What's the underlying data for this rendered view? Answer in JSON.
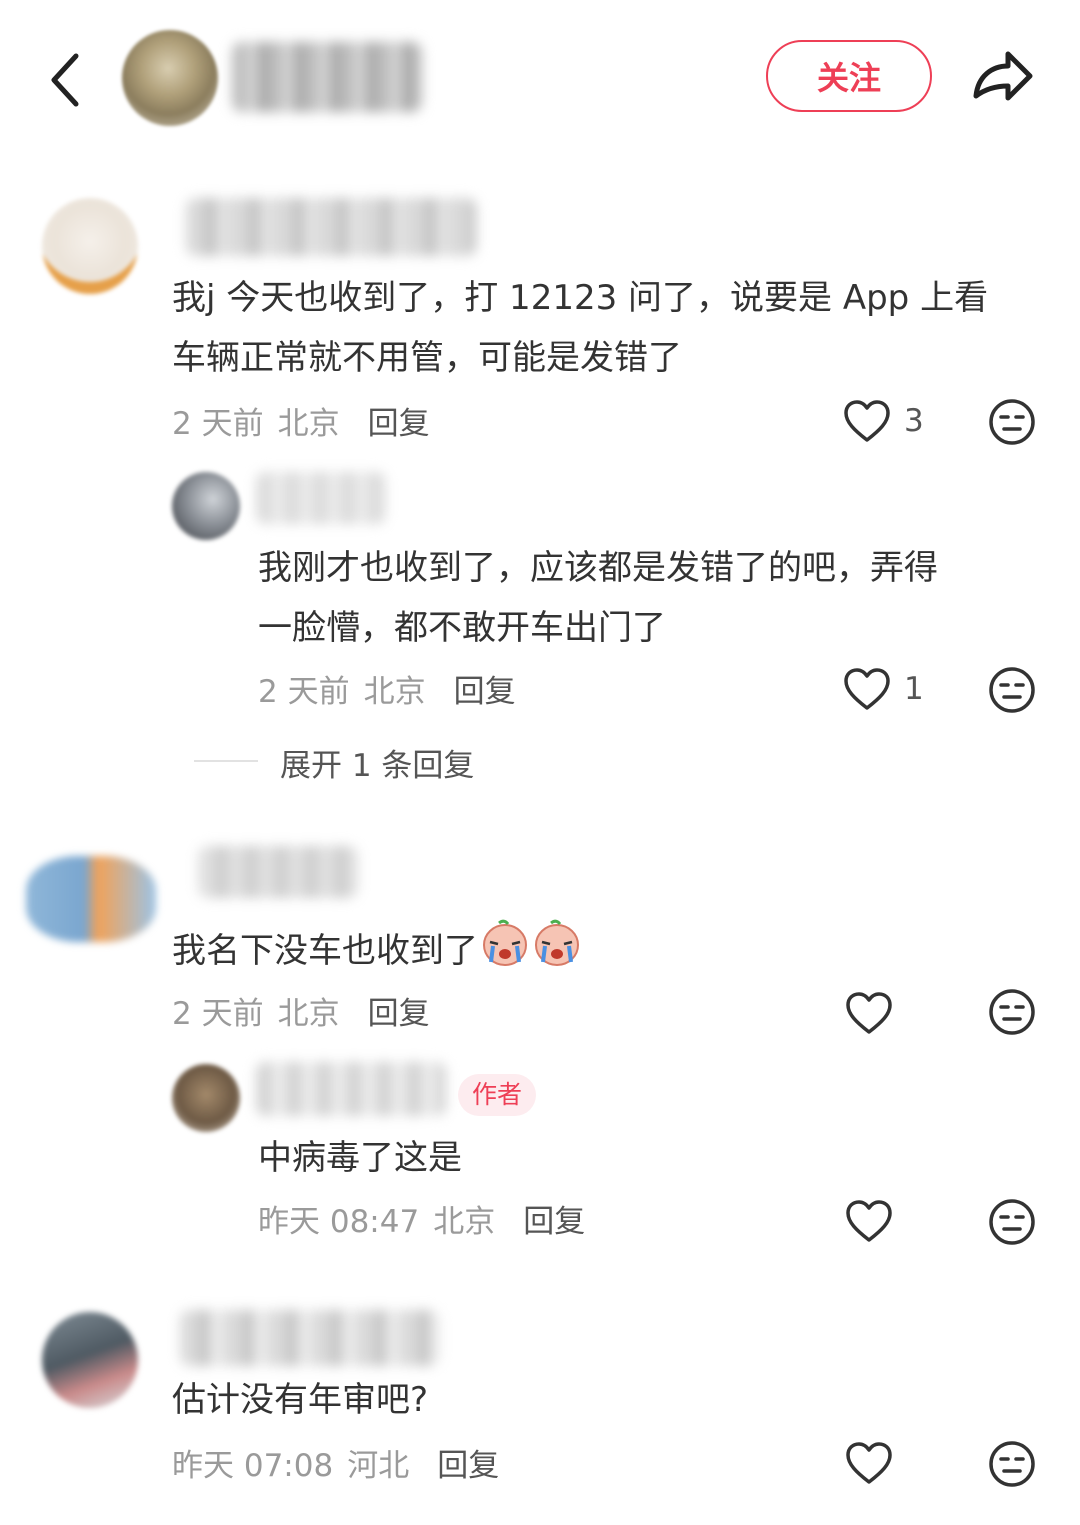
{
  "header": {
    "follow_label": "关注"
  },
  "icons": {
    "back": "chevron-left-icon",
    "share": "share-arrow-icon",
    "like": "heart-outline-icon",
    "emoji": "emoji-face-icon",
    "crying": "crying-emoji-icon"
  },
  "colors": {
    "accent": "#ee3f56",
    "meta": "#9a9a9a"
  },
  "comments": [
    {
      "text_line1": "我j 今天也收到了，打 12123 问了，说要是 App 上看",
      "text_line2": "车辆正常就不用管，可能是发错了",
      "time": "2 天前",
      "location": "北京",
      "reply_label": "回复",
      "likes": "3",
      "replies": [
        {
          "text_line1": "我刚才也收到了，应该都是发错了的吧，弄得",
          "text_line2": "一脸懵，都不敢开车出门了",
          "time": "2 天前",
          "location": "北京",
          "reply_label": "回复",
          "likes": "1"
        }
      ],
      "expand_label": "展开 1 条回复"
    },
    {
      "text": "我名下没车也收到了",
      "time": "2 天前",
      "location": "北京",
      "reply_label": "回复",
      "likes": "",
      "replies": [
        {
          "author_tag": "作者",
          "text": "中病毒了这是",
          "time": "昨天 08:47",
          "location": "北京",
          "reply_label": "回复",
          "likes": ""
        }
      ]
    },
    {
      "text": "估计没有年审吧?",
      "time": "昨天 07:08",
      "location": "河北",
      "reply_label": "回复",
      "likes": ""
    }
  ]
}
